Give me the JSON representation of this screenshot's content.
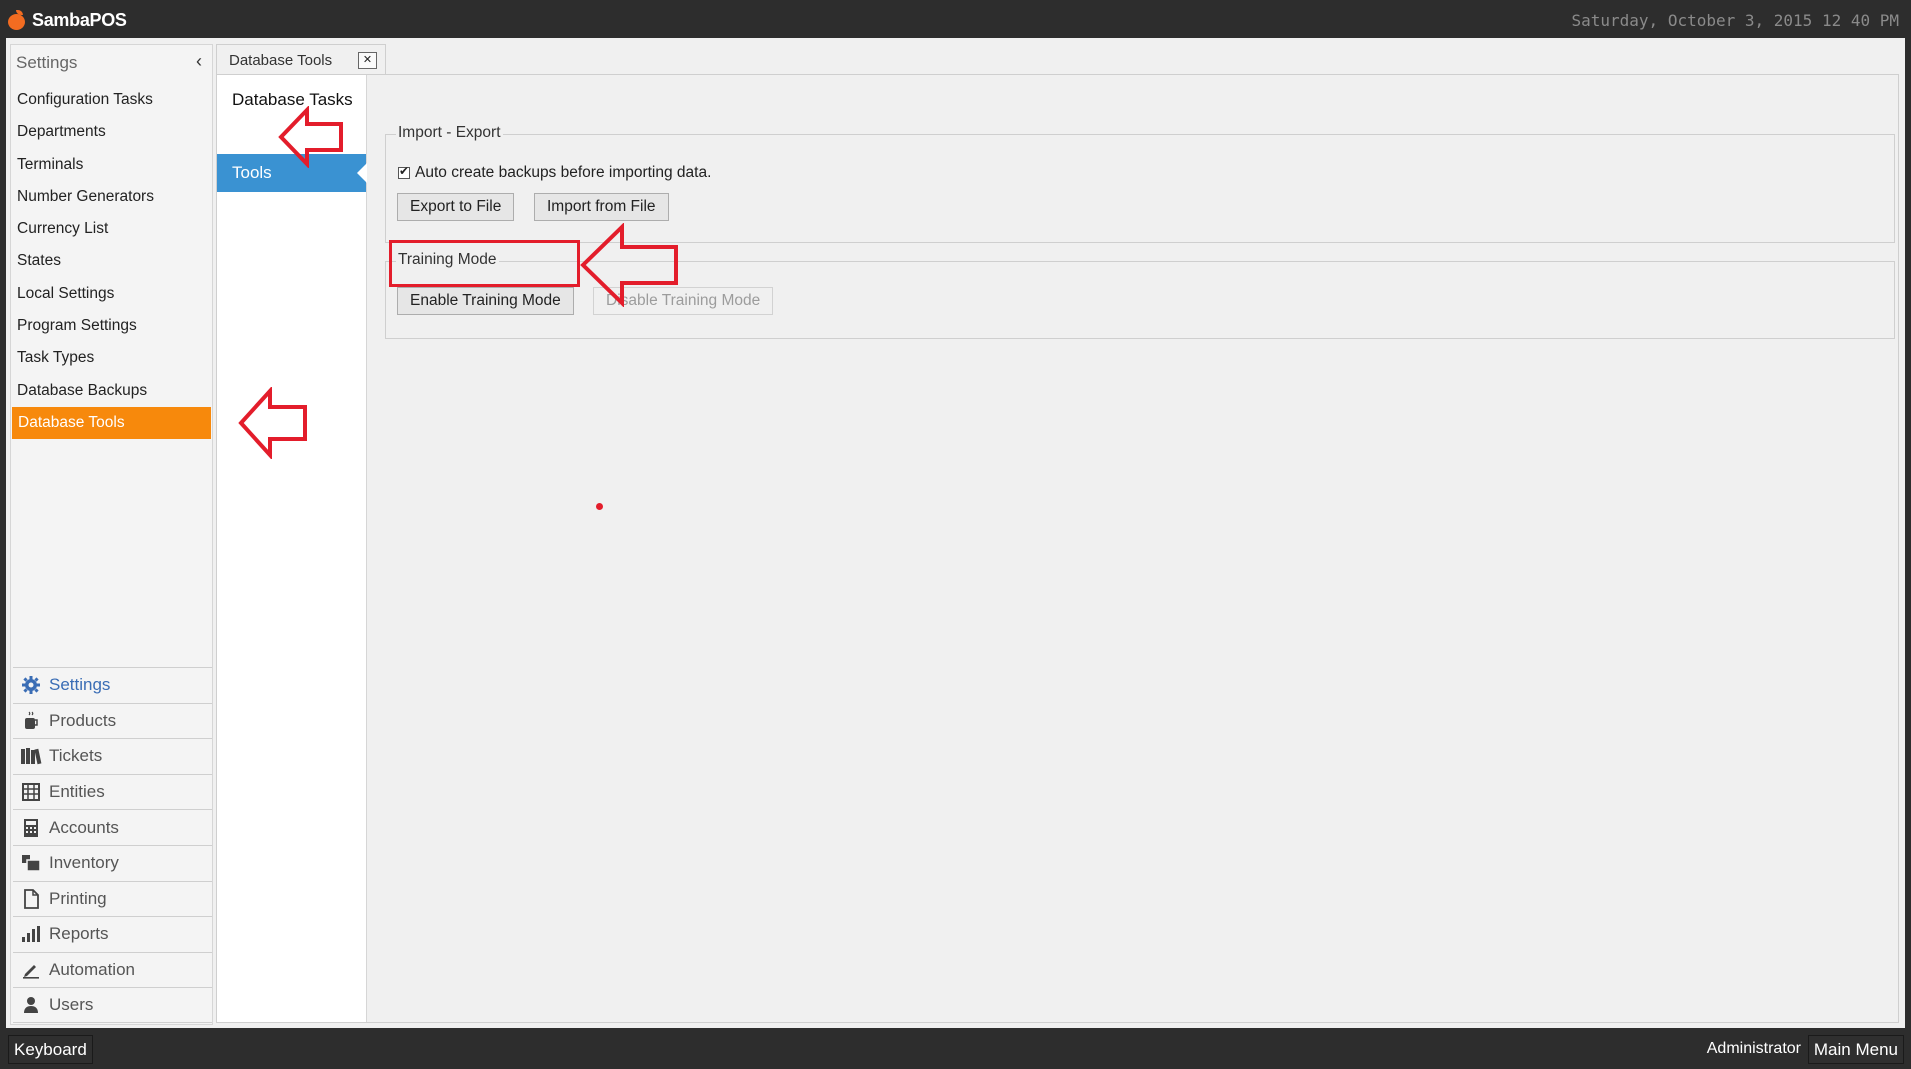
{
  "app": {
    "brand": "SambaPOS",
    "datetime": "Saturday, October 3, 2015 12 40 PM"
  },
  "sidebar": {
    "title": "Settings",
    "collapse_glyph": "‹",
    "items": [
      {
        "label": "Configuration Tasks"
      },
      {
        "label": "Departments"
      },
      {
        "label": "Terminals"
      },
      {
        "label": "Number Generators"
      },
      {
        "label": "Currency List"
      },
      {
        "label": "States"
      },
      {
        "label": "Local Settings"
      },
      {
        "label": "Program Settings"
      },
      {
        "label": "Task Types"
      },
      {
        "label": "Database Backups"
      },
      {
        "label": "Database Tools",
        "active": true
      }
    ],
    "nav": [
      {
        "label": "Settings",
        "icon": "gear-icon",
        "active": true
      },
      {
        "label": "Products",
        "icon": "coffee-icon"
      },
      {
        "label": "Tickets",
        "icon": "books-icon"
      },
      {
        "label": "Entities",
        "icon": "grid-icon"
      },
      {
        "label": "Accounts",
        "icon": "calculator-icon"
      },
      {
        "label": "Inventory",
        "icon": "boxes-icon"
      },
      {
        "label": "Printing",
        "icon": "document-icon"
      },
      {
        "label": "Reports",
        "icon": "bar-chart-icon"
      },
      {
        "label": "Automation",
        "icon": "pen-icon"
      },
      {
        "label": "Users",
        "icon": "user-icon"
      }
    ]
  },
  "document_tab": {
    "label": "Database Tools",
    "close_glyph": "✕"
  },
  "subnav": {
    "items": [
      {
        "label": "Database Tasks"
      },
      {
        "label": "Tools",
        "active": true
      }
    ]
  },
  "import_export": {
    "legend": "Import - Export",
    "auto_backup": {
      "label": "Auto create backups before importing data.",
      "checked": true,
      "tick": "✔"
    },
    "export_button": "Export to File",
    "import_button": "Import from File"
  },
  "training_mode": {
    "legend": "Training Mode",
    "enable_button": "Enable Training Mode",
    "disable_button": "Disable Training Mode"
  },
  "bottom_bar": {
    "keyboard_button": "Keyboard",
    "user": "Administrator",
    "main_menu_button": "Main Menu"
  },
  "colors": {
    "accent_orange": "#f7890c",
    "accent_blue": "#3a92d2",
    "annotation_red": "#e31d2b",
    "chrome_dark": "#2d2d2d"
  }
}
